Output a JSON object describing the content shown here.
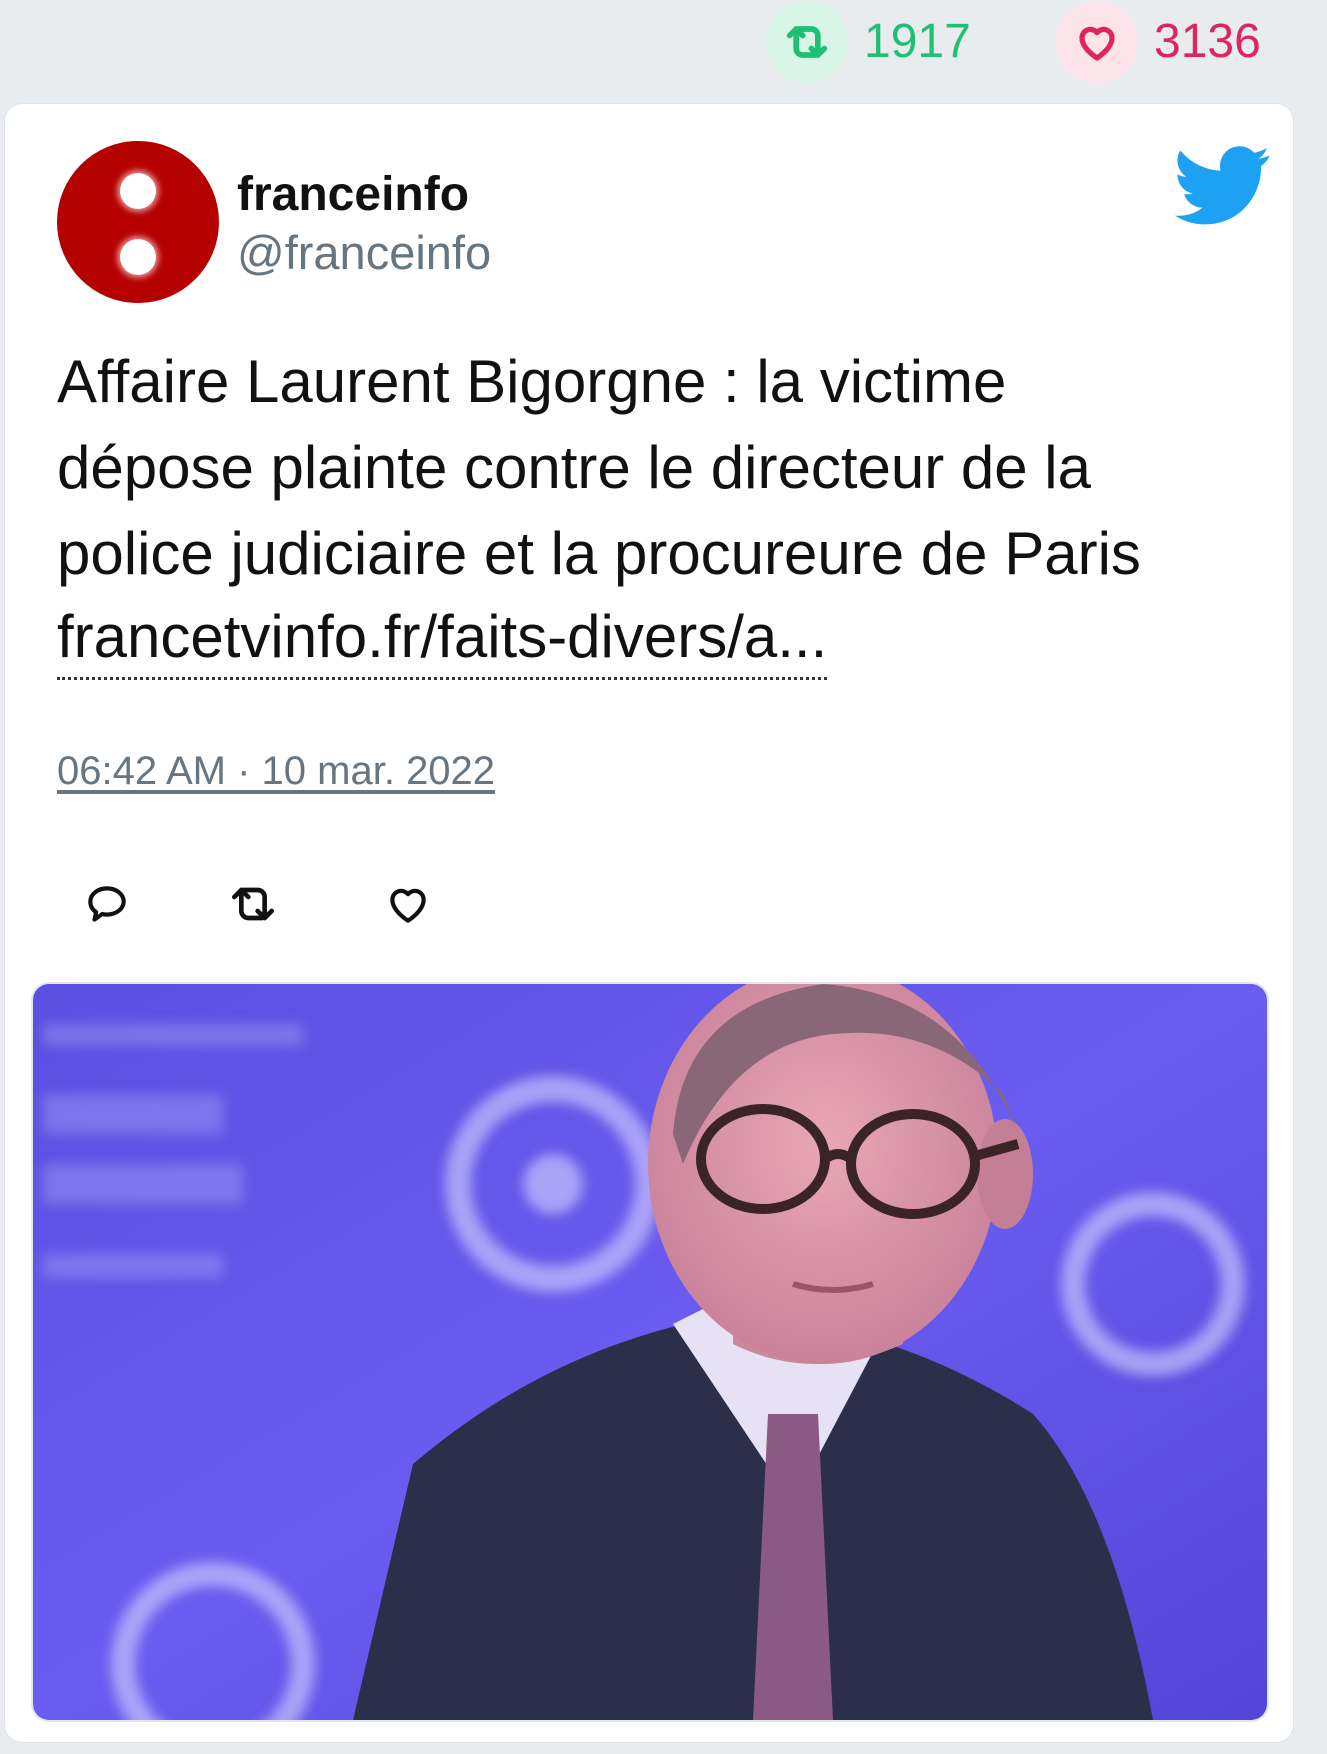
{
  "stats": {
    "retweets": "1917",
    "likes": "3136",
    "retweet_color": "#1fbf75",
    "like_color": "#e0245e"
  },
  "tweet": {
    "author_name": "franceinfo",
    "author_handle": "@franceinfo",
    "text_lines": [
      "Affaire Laurent Bigorgne : la victime",
      "dépose plainte contre le directeur de la",
      "police judiciaire et la procureure de Paris"
    ],
    "link_text": "francetvinfo.fr/faits-divers/a...",
    "timestamp": "06:42 AM · 10 mar. 2022"
  },
  "icons": {
    "brand": "twitter-bird-icon",
    "reply": "reply-icon",
    "retweet": "retweet-icon",
    "like": "heart-icon"
  },
  "brand_color": "#1da1f2"
}
